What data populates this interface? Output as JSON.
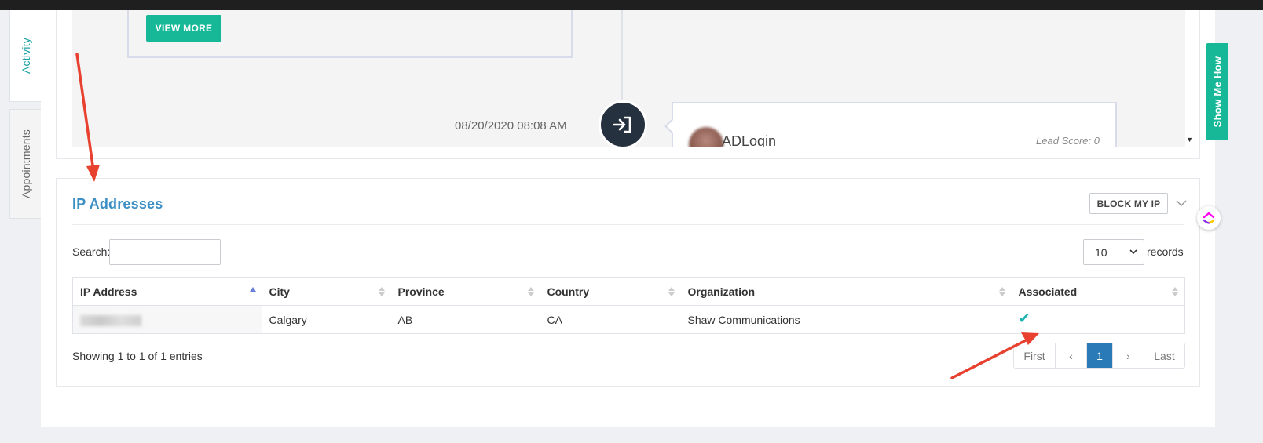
{
  "side_tabs": {
    "activity": "Activity",
    "appointments": "Appointments"
  },
  "timeline": {
    "view_more_label": "VIEW MORE",
    "date": "08/20/2020 08:08 AM",
    "event_title": "ADLogin",
    "lead_score": "Lead Score: 0"
  },
  "ip_section": {
    "title": "IP Addresses",
    "block_button": "BLOCK MY IP",
    "search_label": "Search:",
    "search_value": "",
    "records_value": "10",
    "records_label": "records",
    "columns": [
      "IP Address",
      "City",
      "Province",
      "Country",
      "Organization",
      "Associated"
    ],
    "rows": [
      {
        "ip": "",
        "city": "Calgary",
        "province": "AB",
        "country": "CA",
        "organization": "Shaw Communications",
        "associated": "✔"
      }
    ],
    "showing_text": "Showing 1 to 1 of 1 entries",
    "pagination": {
      "first": "First",
      "prev": "‹",
      "current": "1",
      "next": "›",
      "last": "Last"
    }
  },
  "show_me_how": "Show Me How",
  "colors": {
    "accent": "#17b897",
    "title_blue": "#3b8fc4",
    "page_active": "#2a7ab7",
    "annotation": "#e8412f"
  }
}
